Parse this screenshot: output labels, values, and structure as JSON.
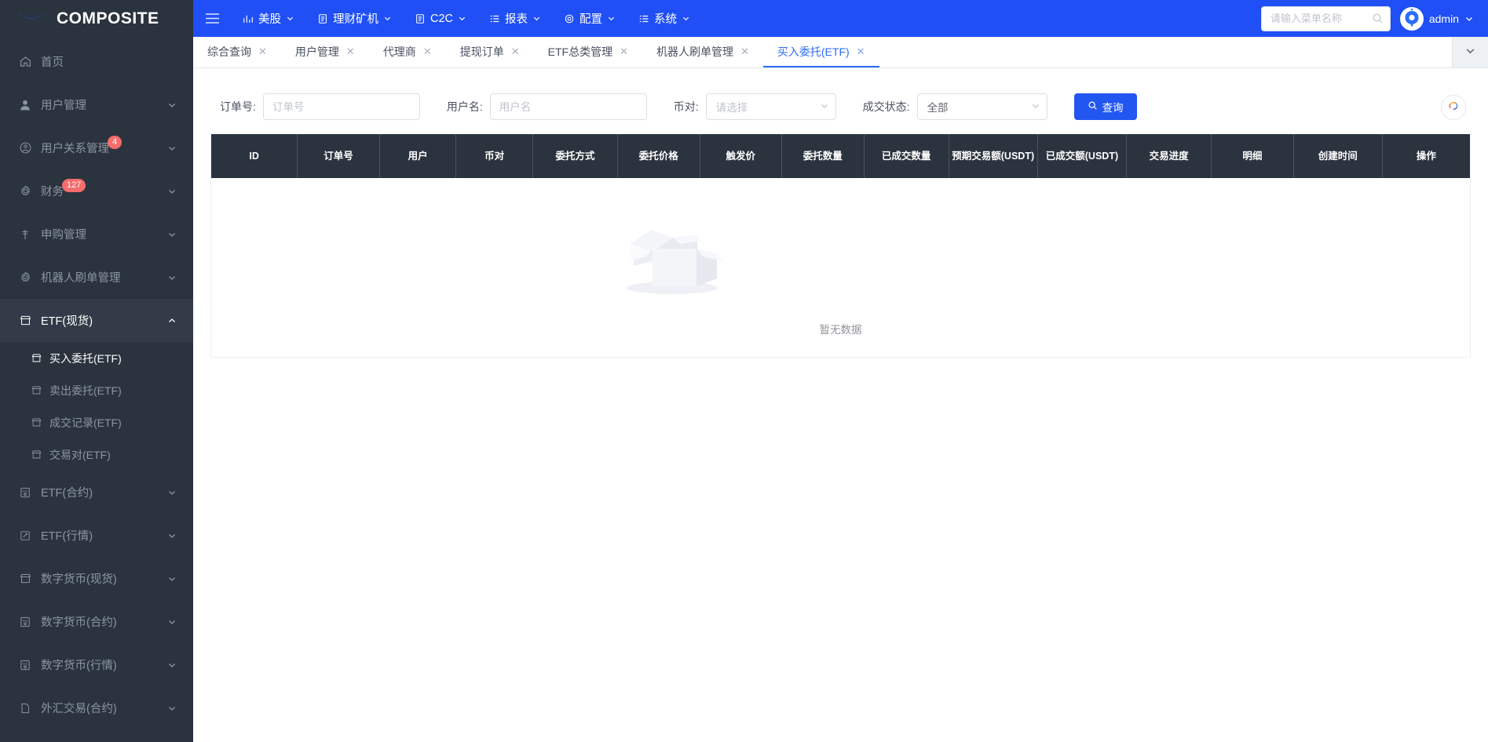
{
  "brand": {
    "name": "COMPOSITE",
    "logo_icon": "crescent-logo-icon",
    "logo_color": "#1a4ef0",
    "sidebar_bg": "#2b333e"
  },
  "topbar": {
    "bg_color": "#1f4ff5",
    "hamburger_icon": "hamburger-icon",
    "nav": [
      {
        "label": "美股",
        "icon": "bar-chart-icon"
      },
      {
        "label": "理财矿机",
        "icon": "document-icon"
      },
      {
        "label": "C2C",
        "icon": "document-icon"
      },
      {
        "label": "报表",
        "icon": "list-icon"
      },
      {
        "label": "配置",
        "icon": "gear-icon"
      },
      {
        "label": "系统",
        "icon": "list-icon"
      }
    ],
    "search": {
      "placeholder": "请输入菜单名称",
      "value": "",
      "icon": "search-icon"
    },
    "user": {
      "name": "admin",
      "avatar_icon": "user-avatar-icon",
      "caret_icon": "chevron-down-icon"
    }
  },
  "sidebar": {
    "items": [
      {
        "label": "首页",
        "icon": "home-icon",
        "expandable": false,
        "badge": "",
        "active": false
      },
      {
        "label": "用户管理",
        "icon": "user-icon",
        "expandable": true,
        "badge": "",
        "active": false
      },
      {
        "label": "用户关系管理",
        "icon": "user-circle-icon",
        "expandable": true,
        "badge": "4",
        "active": false
      },
      {
        "label": "财务",
        "icon": "gear-icon",
        "expandable": true,
        "badge": "127",
        "active": false
      },
      {
        "label": "申购管理",
        "icon": "bank-icon",
        "expandable": true,
        "badge": "",
        "active": false
      },
      {
        "label": "机器人刷单管理",
        "icon": "gear-icon",
        "expandable": true,
        "badge": "",
        "active": false
      },
      {
        "label": "ETF(现货)",
        "icon": "shop-icon",
        "expandable": true,
        "badge": "",
        "active": true
      },
      {
        "label": "ETF(合约)",
        "icon": "sql-icon",
        "expandable": true,
        "badge": "",
        "active": false
      },
      {
        "label": "ETF(行情)",
        "icon": "edit-icon",
        "expandable": true,
        "badge": "",
        "active": false
      },
      {
        "label": "数字货币(现货)",
        "icon": "shop-icon",
        "expandable": true,
        "badge": "",
        "active": false
      },
      {
        "label": "数字货币(合约)",
        "icon": "sql-icon",
        "expandable": true,
        "badge": "",
        "active": false
      },
      {
        "label": "数字货币(行情)",
        "icon": "sql-icon",
        "expandable": true,
        "badge": "",
        "active": false
      },
      {
        "label": "外汇交易(合约)",
        "icon": "document-icon",
        "expandable": true,
        "badge": "",
        "active": false
      }
    ],
    "submenu": [
      {
        "label": "买入委托(ETF)",
        "icon": "shop-icon",
        "active": true
      },
      {
        "label": "卖出委托(ETF)",
        "icon": "shop-icon",
        "active": false
      },
      {
        "label": "成交记录(ETF)",
        "icon": "shop-icon",
        "active": false
      },
      {
        "label": "交易对(ETF)",
        "icon": "shop-icon",
        "active": false
      }
    ],
    "badge_color": "#f56c6c"
  },
  "tabs": {
    "items": [
      {
        "label": "综合查询",
        "active": false
      },
      {
        "label": "用户管理",
        "active": false
      },
      {
        "label": "代理商",
        "active": false
      },
      {
        "label": "提现订单",
        "active": false
      },
      {
        "label": "ETF总类管理",
        "active": false
      },
      {
        "label": "机器人刷单管理",
        "active": false
      },
      {
        "label": "买入委托(ETF)",
        "active": true
      }
    ],
    "close_icon": "close-icon",
    "dropdown_icon": "chevron-down-icon",
    "active_color": "#2d6bf5"
  },
  "filters": {
    "order_no": {
      "label": "订单号:",
      "placeholder": "订单号",
      "value": ""
    },
    "user_name": {
      "label": "用户名:",
      "placeholder": "用户名",
      "value": ""
    },
    "pair": {
      "label": "币对:",
      "placeholder": "请选择",
      "value": "",
      "caret_icon": "chevron-down-icon"
    },
    "deal_status": {
      "label": "成交状态:",
      "value": "全部",
      "caret_icon": "chevron-down-icon"
    },
    "query_button": {
      "label": "查询",
      "icon": "search-icon",
      "color": "#2256f0"
    },
    "refresh_button": {
      "icon": "refresh-icon"
    }
  },
  "table": {
    "columns": [
      "ID",
      "订单号",
      "用户",
      "币对",
      "委托方式",
      "委托价格",
      "触发价",
      "委托数量",
      "已成交数量",
      "预期交易额(USDT)",
      "已成交额(USDT)",
      "交易进度",
      "明细",
      "创建时间",
      "操作"
    ],
    "rows": [],
    "empty_text": "暂无数据",
    "empty_icon": "empty-box-icon",
    "header_bg": "#2b333e"
  }
}
